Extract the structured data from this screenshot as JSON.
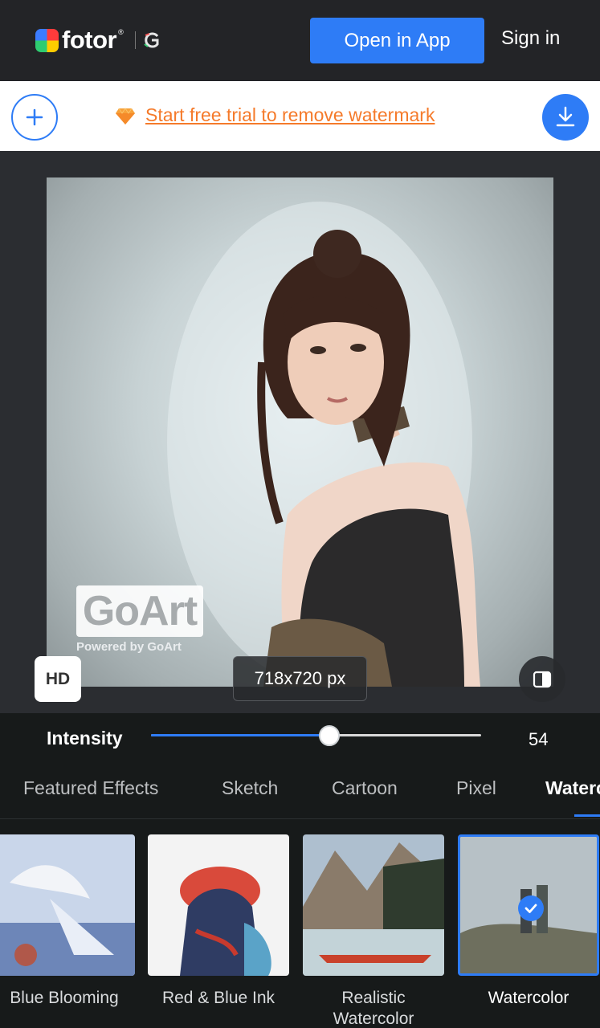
{
  "header": {
    "logo_text": "fotor",
    "logo_reg": "®",
    "open_app_label": "Open in App",
    "sign_in_label": "Sign in"
  },
  "promo": {
    "link_text": "Start free trial to remove watermark"
  },
  "canvas": {
    "watermark_title": "GoArt",
    "watermark_sub": "Powered by GoArt",
    "hd_label": "HD",
    "size_label": "718x720 px"
  },
  "intensity": {
    "label": "Intensity",
    "value": "54",
    "fraction": 0.54
  },
  "tabs": [
    {
      "label": "Featured Effects"
    },
    {
      "label": "Sketch"
    },
    {
      "label": "Cartoon"
    },
    {
      "label": "Pixel"
    },
    {
      "label": "Watercolor"
    }
  ],
  "effects": [
    {
      "label": "Blue Blooming"
    },
    {
      "label": "Red & Blue Ink"
    },
    {
      "label": "Realistic Watercolor"
    },
    {
      "label": "Watercolor"
    }
  ],
  "colors": {
    "accent": "#2e7cf6",
    "promo_link": "#f57a2a",
    "header_bg": "#232427",
    "panel_bg": "#171a1a"
  }
}
